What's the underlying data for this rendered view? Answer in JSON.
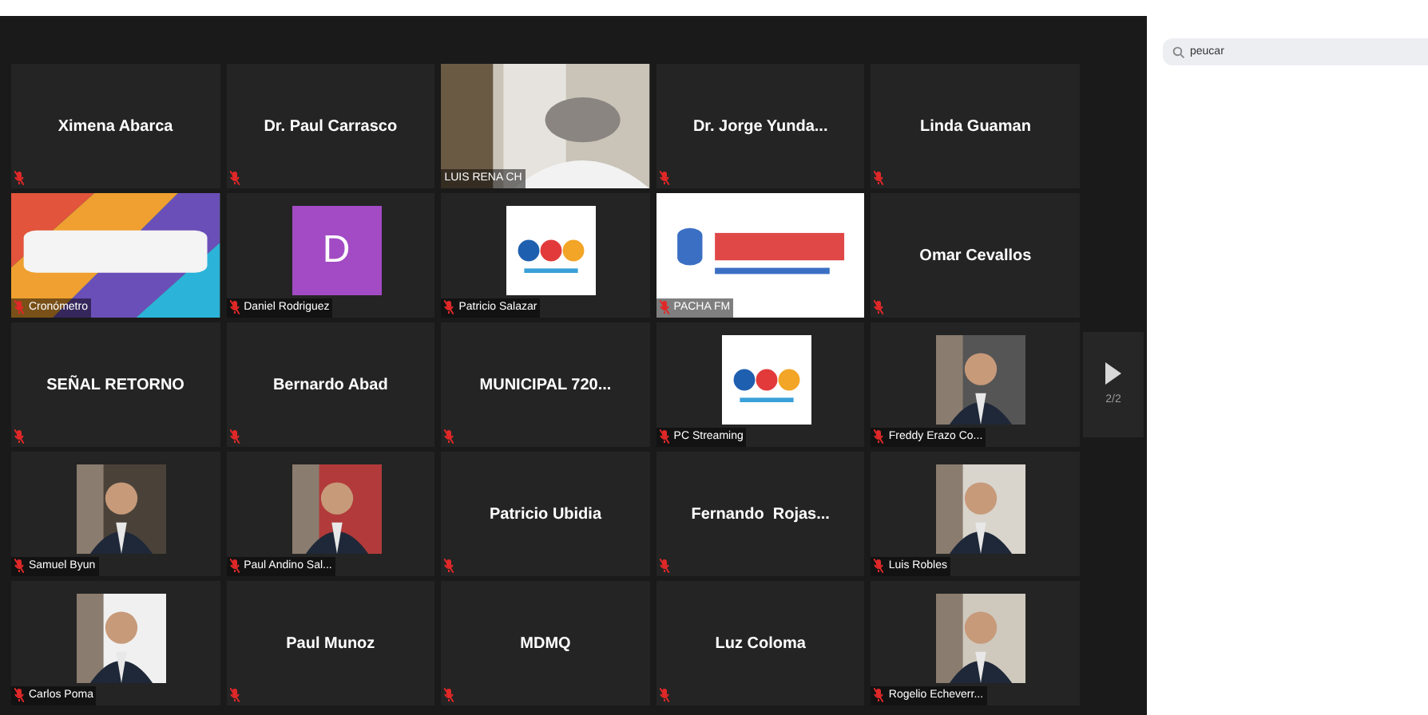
{
  "gallery": {
    "tiles": [
      {
        "kind": "name",
        "name": "Ximena Abarca",
        "muted": true
      },
      {
        "kind": "name",
        "name": "Dr. Paul Carrasco",
        "muted": true
      },
      {
        "kind": "video",
        "label": "LUIS RENA CH",
        "muted": false
      },
      {
        "kind": "name",
        "name": "Dr. Jorge Yunda...",
        "muted": true
      },
      {
        "kind": "name",
        "name": "Linda Guaman",
        "muted": true
      },
      {
        "kind": "video",
        "label": "Cronómetro",
        "muted": true
      },
      {
        "kind": "letter",
        "letter": "D",
        "color": "#a24bc4",
        "label": "Daniel Rodriguez",
        "muted": true
      },
      {
        "kind": "thumb",
        "label": "Patricio Salazar",
        "muted": true
      },
      {
        "kind": "video",
        "label": "PACHA FM",
        "muted": true
      },
      {
        "kind": "name",
        "name": "Omar Cevallos",
        "muted": true
      },
      {
        "kind": "name",
        "name": "SEÑAL RETORNO",
        "muted": true
      },
      {
        "kind": "name",
        "name": "Bernardo Abad",
        "muted": true
      },
      {
        "kind": "name",
        "name": "MUNICIPAL 720...",
        "muted": true
      },
      {
        "kind": "thumb",
        "label": "PC Streaming",
        "muted": true
      },
      {
        "kind": "thumb",
        "label": "Freddy Erazo Co...",
        "muted": true
      },
      {
        "kind": "thumb",
        "label": "Samuel Byun",
        "muted": true
      },
      {
        "kind": "thumb",
        "label": "Paul Andino Sal...",
        "muted": true
      },
      {
        "kind": "name",
        "name": "Patricio Ubidia",
        "muted": true
      },
      {
        "kind": "name",
        "name": "Fernando  Rojas...",
        "muted": true
      },
      {
        "kind": "thumb",
        "label": "Luis Robles",
        "muted": true
      },
      {
        "kind": "thumb",
        "label": "Carlos Poma",
        "muted": true
      },
      {
        "kind": "name",
        "name": "Paul Munoz",
        "muted": true
      },
      {
        "kind": "name",
        "name": "MDMQ",
        "muted": true
      },
      {
        "kind": "name",
        "name": "Luz Coloma",
        "muted": true
      },
      {
        "kind": "thumb",
        "label": "Rogelio Echeverr...",
        "muted": true
      }
    ],
    "pager": {
      "page": "2/2"
    }
  },
  "panel": {
    "search": {
      "value": "peucar"
    }
  }
}
